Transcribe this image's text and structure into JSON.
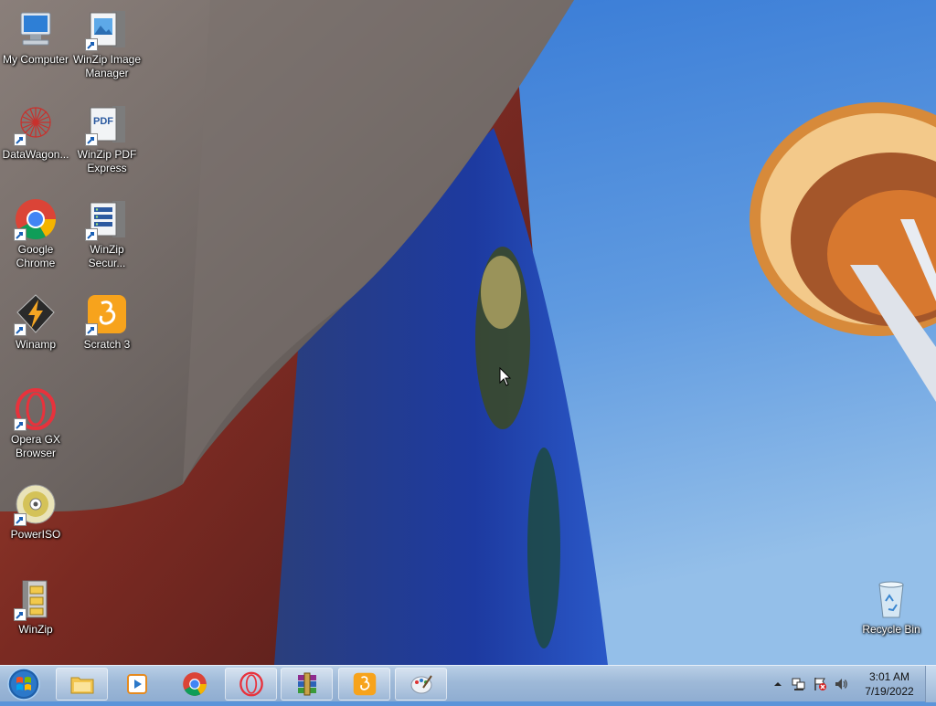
{
  "desktop": {
    "icons": [
      {
        "label": "My Computer",
        "icon": "computer-icon"
      },
      {
        "label": "WinZip Image Manager",
        "icon": "winzip-image-manager-icon"
      },
      {
        "label": "DataWagon...",
        "icon": "datawagon-icon"
      },
      {
        "label": "WinZip PDF Express",
        "icon": "winzip-pdf-express-icon"
      },
      {
        "label": "Google Chrome",
        "icon": "chrome-icon"
      },
      {
        "label": "WinZip Secur...",
        "icon": "winzip-secure-backup-icon"
      },
      {
        "label": "Winamp",
        "icon": "winamp-icon"
      },
      {
        "label": "Scratch 3",
        "icon": "scratch-icon"
      },
      {
        "label": "Opera GX Browser",
        "icon": "opera-gx-icon"
      },
      {
        "label": "PowerISO",
        "icon": "poweriso-icon"
      },
      {
        "label": "WinZip",
        "icon": "winzip-icon"
      },
      {
        "label": "Recycle Bin",
        "icon": "recycle-bin-icon"
      }
    ]
  },
  "taskbar": {
    "start_icon": "windows-start-orb-icon",
    "pinned": [
      {
        "name": "file-explorer",
        "icon": "folder-icon"
      },
      {
        "name": "media-player",
        "icon": "media-player-icon"
      },
      {
        "name": "chrome",
        "icon": "chrome-icon"
      },
      {
        "name": "opera-gx",
        "icon": "opera-gx-icon"
      },
      {
        "name": "winrar",
        "icon": "winrar-icon"
      },
      {
        "name": "scratch",
        "icon": "scratch-icon"
      },
      {
        "name": "paint",
        "icon": "paint-palette-icon"
      }
    ],
    "tray": {
      "icons": [
        "show-hidden-icons-chevron-icon",
        "network-icon",
        "action-center-flag-icon",
        "volume-icon"
      ],
      "time": "3:01 AM",
      "date": "7/19/2022"
    }
  },
  "colors": {
    "sky": "#4f8ede",
    "taskbar": "#9eb9d8",
    "chrome_red": "#db4437",
    "chrome_green": "#0f9d58",
    "chrome_yellow": "#f4b400",
    "chrome_blue": "#4285f4",
    "opera_red": "#e8323c",
    "scratch_orange": "#f7a31c"
  }
}
